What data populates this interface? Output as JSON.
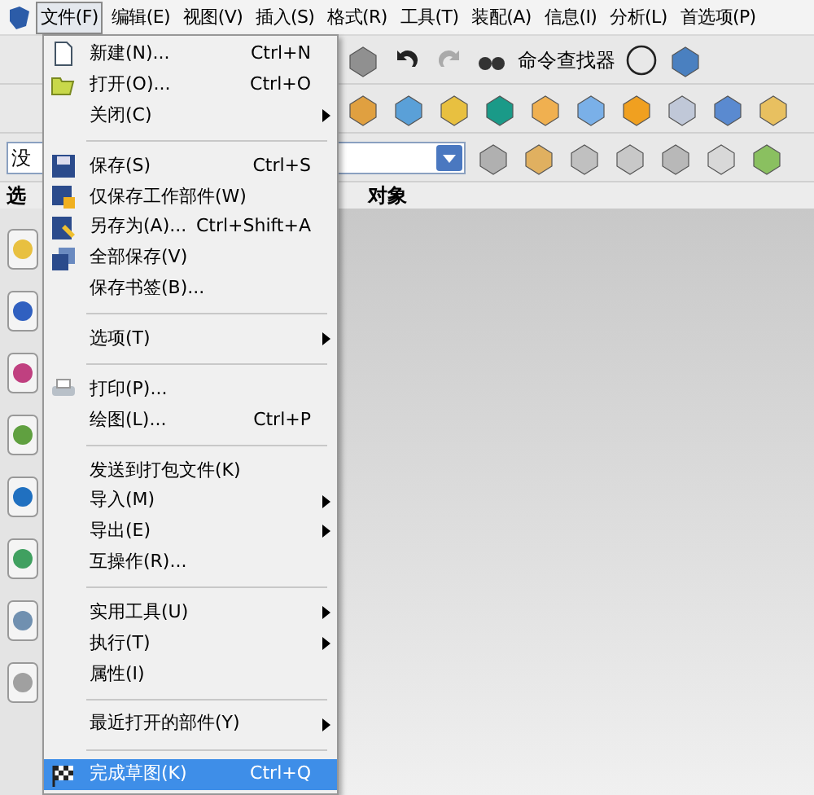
{
  "menu_bar": [
    {
      "label": "文件(F)",
      "selected": true
    },
    {
      "label": "编辑(E)",
      "selected": false
    },
    {
      "label": "视图(V)",
      "selected": false
    },
    {
      "label": "插入(S)",
      "selected": false
    },
    {
      "label": "格式(R)",
      "selected": false
    },
    {
      "label": "工具(T)",
      "selected": false
    },
    {
      "label": "装配(A)",
      "selected": false
    },
    {
      "label": "信息(I)",
      "selected": false
    },
    {
      "label": "分析(L)",
      "selected": false
    },
    {
      "label": "首选项(P)",
      "selected": false
    }
  ],
  "toolbar": {
    "command_finder": "命令查找器"
  },
  "filter_field": {
    "value": "没"
  },
  "status": {
    "left": "选",
    "right": "对象"
  },
  "file_menu": [
    {
      "kind": "item",
      "label": "新建(N)...",
      "shortcut": "Ctrl+N",
      "submenu": false,
      "selected": false
    },
    {
      "kind": "item",
      "label": "打开(O)...",
      "shortcut": "Ctrl+O",
      "submenu": false,
      "selected": false
    },
    {
      "kind": "item",
      "label": "关闭(C)",
      "submenu": true,
      "selected": false
    },
    {
      "kind": "separator"
    },
    {
      "kind": "item",
      "label": "保存(S)",
      "shortcut": "Ctrl+S",
      "submenu": false,
      "selected": false
    },
    {
      "kind": "item",
      "label": "仅保存工作部件(W)",
      "submenu": false,
      "selected": false
    },
    {
      "kind": "item",
      "label": "另存为(A)...",
      "shortcut": "Ctrl+Shift+A",
      "submenu": false,
      "selected": false
    },
    {
      "kind": "item",
      "label": "全部保存(V)",
      "submenu": false,
      "selected": false
    },
    {
      "kind": "item",
      "label": "保存书签(B)...",
      "submenu": false,
      "selected": false
    },
    {
      "kind": "separator"
    },
    {
      "kind": "item",
      "label": "选项(T)",
      "submenu": true,
      "selected": false
    },
    {
      "kind": "separator"
    },
    {
      "kind": "item",
      "label": "打印(P)...",
      "submenu": false,
      "selected": false
    },
    {
      "kind": "item",
      "label": "绘图(L)...",
      "shortcut": "Ctrl+P",
      "submenu": false,
      "selected": false
    },
    {
      "kind": "separator"
    },
    {
      "kind": "item",
      "label": "发送到打包文件(K)",
      "submenu": false,
      "selected": false
    },
    {
      "kind": "item",
      "label": "导入(M)",
      "submenu": true,
      "selected": false
    },
    {
      "kind": "item",
      "label": "导出(E)",
      "submenu": true,
      "selected": false
    },
    {
      "kind": "item",
      "label": "互操作(R)...",
      "submenu": false,
      "selected": false
    },
    {
      "kind": "separator"
    },
    {
      "kind": "item",
      "label": "实用工具(U)",
      "submenu": true,
      "selected": false
    },
    {
      "kind": "item",
      "label": "执行(T)",
      "submenu": true,
      "selected": false
    },
    {
      "kind": "item",
      "label": "属性(I)",
      "submenu": false,
      "selected": false
    },
    {
      "kind": "separator"
    },
    {
      "kind": "item",
      "label": "最近打开的部件(Y)",
      "submenu": true,
      "selected": false
    },
    {
      "kind": "separator"
    },
    {
      "kind": "item",
      "label": "完成草图(K)",
      "shortcut": "Ctrl+Q",
      "submenu": false,
      "selected": true
    }
  ]
}
